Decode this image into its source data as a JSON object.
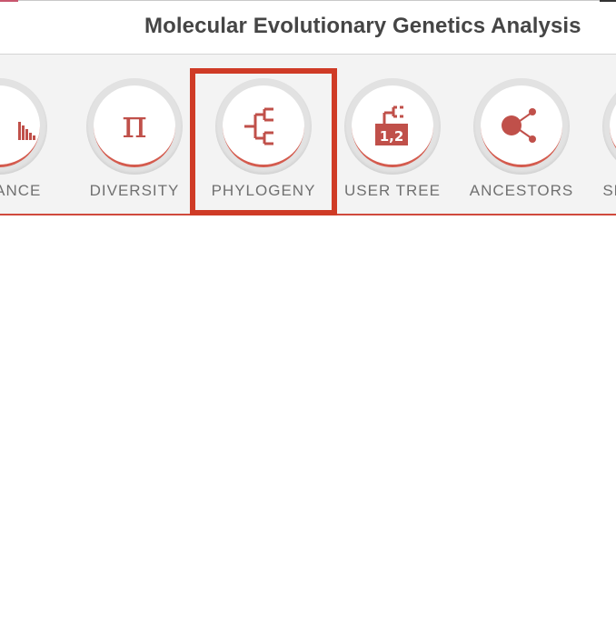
{
  "window": {
    "title": "Molecular Evolutionary Genetics Analysis"
  },
  "toolbar": {
    "items": [
      {
        "label": "DISTANCE",
        "icon": "distance-histogram-icon"
      },
      {
        "label": "DIVERSITY",
        "icon": "pi-icon",
        "glyph": "π"
      },
      {
        "label": "PHYLOGENY",
        "icon": "phylogeny-tree-icon"
      },
      {
        "label": "USER TREE",
        "icon": "user-tree-icon",
        "badge": "1,2"
      },
      {
        "label": "ANCESTORS",
        "icon": "ancestors-icon"
      },
      {
        "label": "SELECTION",
        "icon": "selection-icon"
      }
    ],
    "highlighted": "PHYLOGENY"
  },
  "colors": {
    "accent": "#d04a3c",
    "icon": "#c0504a",
    "highlight_box": "#cf3b26",
    "toolbar_bg": "#f3f3f3",
    "label_text": "#707070"
  }
}
